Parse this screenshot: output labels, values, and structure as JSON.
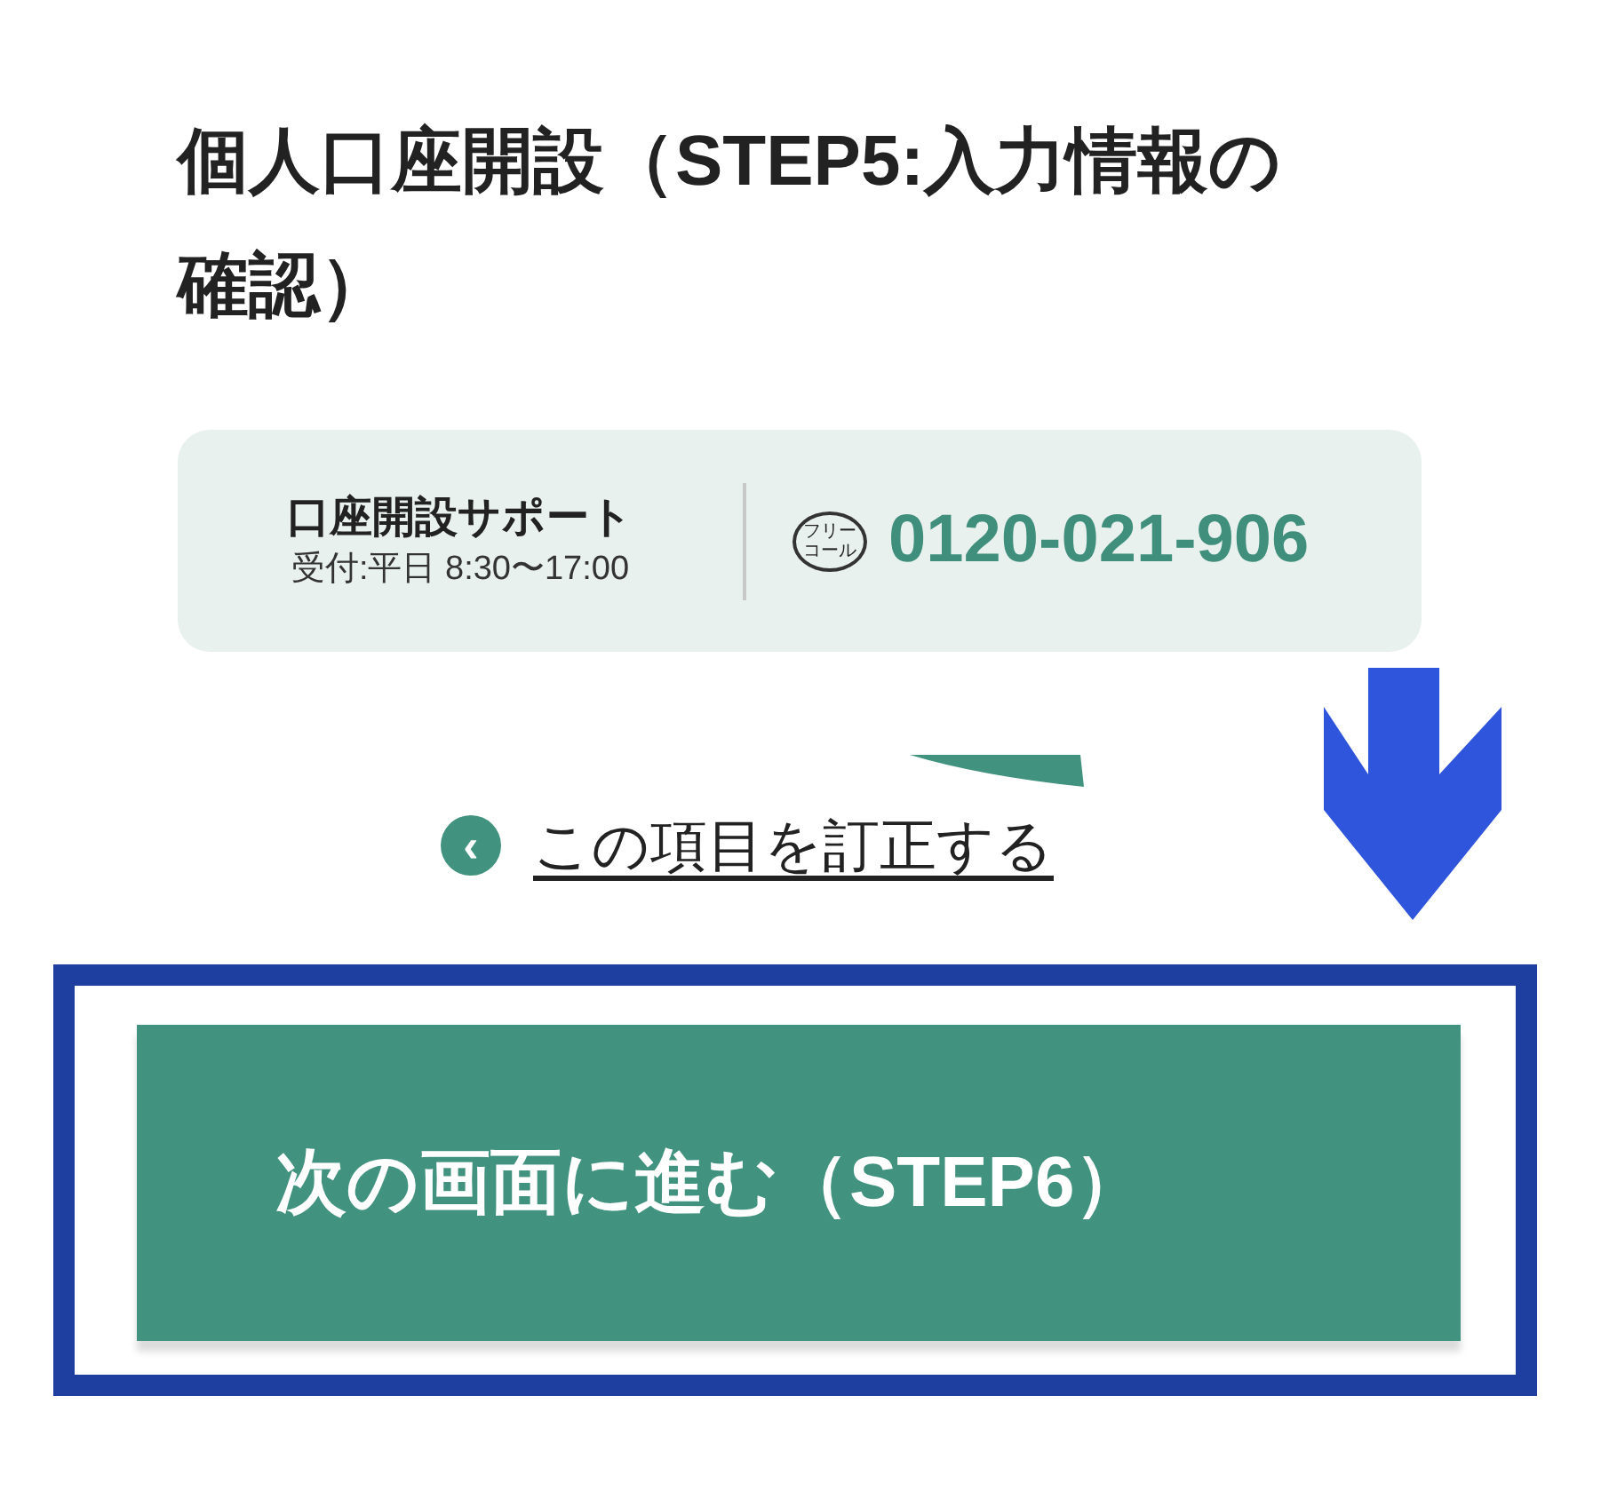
{
  "page_title": "個人口座開設（STEP5:入力情報の確認）",
  "support": {
    "title": "口座開設サポート",
    "hours": "受付:平日 8:30〜17:00",
    "free_dial_mark": [
      "フリー",
      "コール"
    ],
    "phone": "0120-021-906"
  },
  "correct_link": {
    "icon": "‹",
    "label": "この項目を訂正する"
  },
  "next_button": {
    "label": "次の画面に進む（STEP6）"
  },
  "annotations": {
    "arrow": true,
    "frame": true
  }
}
